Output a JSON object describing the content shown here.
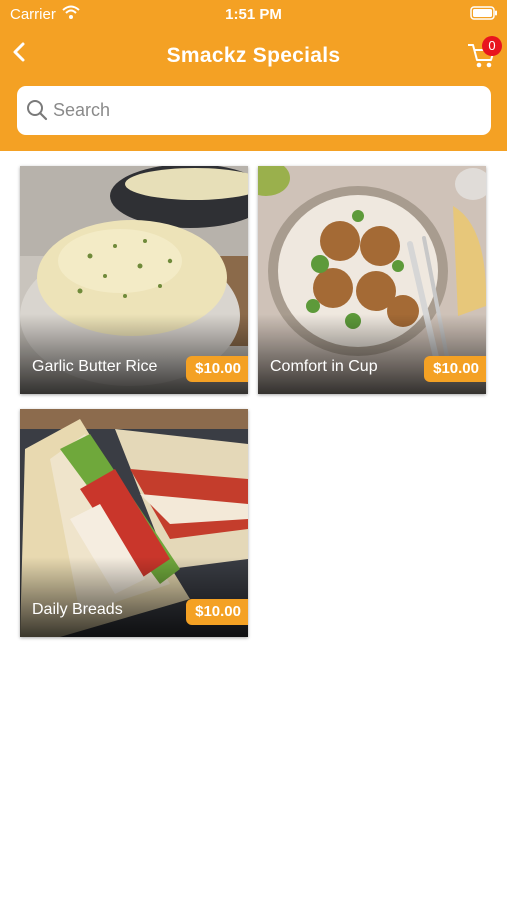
{
  "status_bar": {
    "carrier": "Carrier",
    "time": "1:51 PM"
  },
  "nav": {
    "title": "Smackz Specials",
    "cart_count": "0"
  },
  "search": {
    "placeholder": "Search",
    "value": ""
  },
  "products": [
    {
      "name": "Garlic Butter Rice",
      "price": "$10.00"
    },
    {
      "name": "Comfort in Cup",
      "price": "$10.00"
    },
    {
      "name": "Daily Breads",
      "price": "$10.00"
    }
  ],
  "colors": {
    "accent": "#f4a124",
    "badge": "#e8141e"
  }
}
